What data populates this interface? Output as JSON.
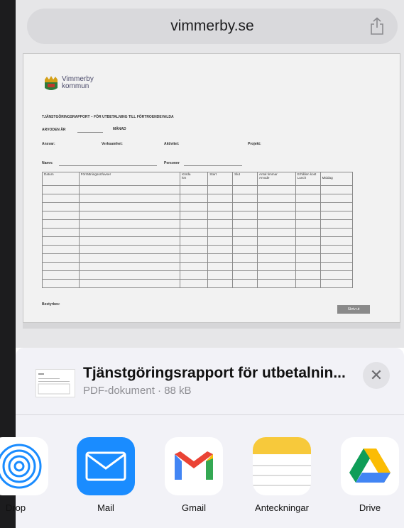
{
  "browser": {
    "url": "vimmerby.se"
  },
  "pdf": {
    "logo_line1": "Vimmerby",
    "logo_line2": "kommun",
    "title": "TJÄNSTGÖRINGSRAPPORT – FÖR UTBETALNING TILL FÖRTROENDEVALDA",
    "arvoden": "ARVODEN ÅR",
    "manad": "MÅNAD",
    "ansvar": "Ansvar:",
    "verksamhet": "Verksamhet:",
    "aktivitet": "Aktivitet:",
    "projekt": "Projekt:",
    "namn": "Namn:",
    "personnr": "Personnr",
    "columns": {
      "datum": "Datum",
      "forrattning": "Förrättningsort/avser",
      "korda": "Körda",
      "km": "km",
      "start": "Start",
      "slut": "Slut",
      "antal": "Antal timmar",
      "arvode": "Arvode",
      "erhallen": "Erhållen kost",
      "lunch": "Lunch",
      "middag": "Middag"
    },
    "bestyrkes": "Bestyrkes:",
    "print_label": "Skriv ut"
  },
  "share": {
    "file_name": "Tjänstgöringsrapport för utbetalnin...",
    "file_meta": "PDF-dokument · 88 kB",
    "apps": [
      {
        "label": "Drop",
        "icon": "airdrop-icon"
      },
      {
        "label": "Mail",
        "icon": "mail-icon"
      },
      {
        "label": "Gmail",
        "icon": "gmail-icon"
      },
      {
        "label": "Anteckningar",
        "icon": "notes-icon"
      },
      {
        "label": "Drive",
        "icon": "google-drive-icon"
      }
    ]
  },
  "colors": {
    "mail_blue": "#1a8cff",
    "notes_yellow": "#f7c93b",
    "sheet_bg": "#f2f2f7"
  }
}
